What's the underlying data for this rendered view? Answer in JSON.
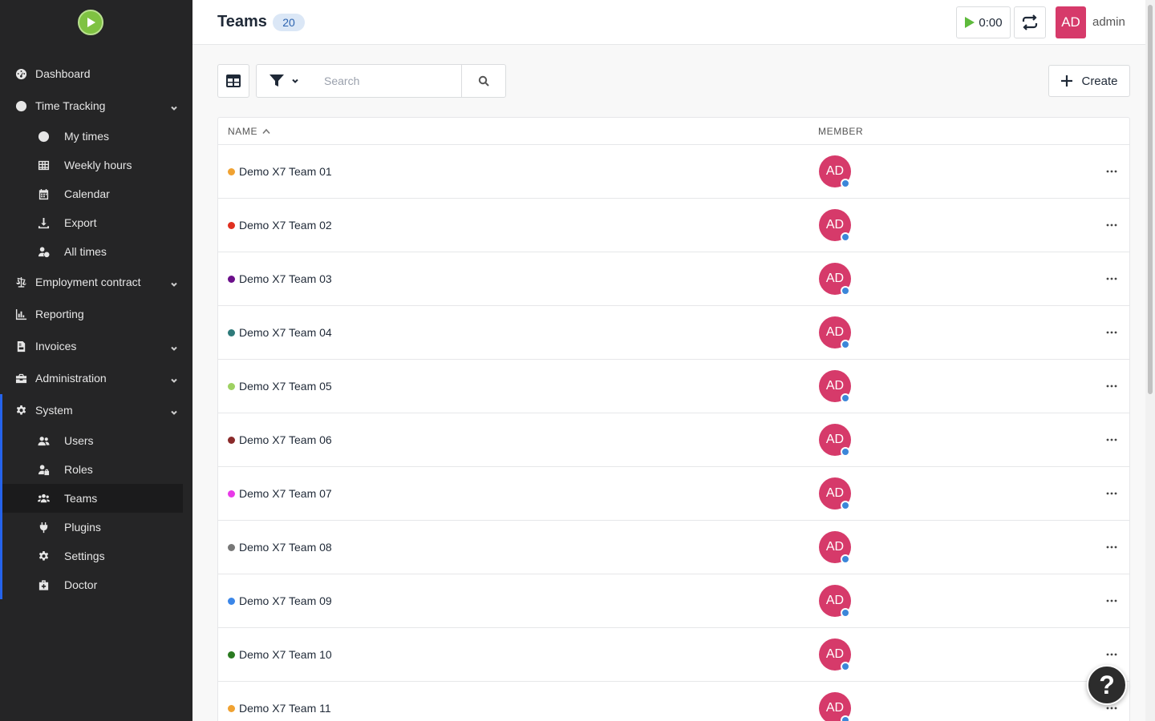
{
  "sidebar": {
    "logo_icon": "play-logo-icon",
    "items": [
      {
        "label": "Dashboard",
        "icon": "dashboard-icon"
      },
      {
        "label": "Time Tracking",
        "icon": "clock-icon"
      },
      {
        "label": "My times",
        "icon": "clock-icon"
      },
      {
        "label": "Weekly hours",
        "icon": "table-icon"
      },
      {
        "label": "Calendar",
        "icon": "calendar-icon"
      },
      {
        "label": "Export",
        "icon": "download-icon"
      },
      {
        "label": "All times",
        "icon": "user-clock-icon"
      },
      {
        "label": "Employment contract",
        "icon": "balance-scale-icon"
      },
      {
        "label": "Reporting",
        "icon": "chart-icon"
      },
      {
        "label": "Invoices",
        "icon": "invoice-icon"
      },
      {
        "label": "Administration",
        "icon": "toolbox-icon"
      },
      {
        "label": "System",
        "icon": "gear-icon"
      },
      {
        "label": "Users",
        "icon": "users-icon"
      },
      {
        "label": "Roles",
        "icon": "user-lock-icon"
      },
      {
        "label": "Teams",
        "icon": "team-icon"
      },
      {
        "label": "Plugins",
        "icon": "plug-icon"
      },
      {
        "label": "Settings",
        "icon": "gear-icon"
      },
      {
        "label": "Doctor",
        "icon": "medkit-icon"
      }
    ],
    "active_item": "Teams",
    "accent_color": "#2563eb"
  },
  "header": {
    "title": "Teams",
    "count": "20",
    "timer": "0:00",
    "user_initials": "AD",
    "user_name": "admin",
    "user_color": "#d63a6a"
  },
  "toolbar": {
    "search_placeholder": "Search",
    "create_label": "Create"
  },
  "table": {
    "columns": {
      "name": "Name",
      "member": "Member"
    },
    "sort_column": "name",
    "sort_direction": "asc",
    "rows": [
      {
        "name": "Demo X7 Team 01",
        "color": "#f0a232",
        "member": "AD"
      },
      {
        "name": "Demo X7 Team 02",
        "color": "#e03020",
        "member": "AD"
      },
      {
        "name": "Demo X7 Team 03",
        "color": "#6b0f8a",
        "member": "AD"
      },
      {
        "name": "Demo X7 Team 04",
        "color": "#2e7a7a",
        "member": "AD"
      },
      {
        "name": "Demo X7 Team 05",
        "color": "#9ed162",
        "member": "AD"
      },
      {
        "name": "Demo X7 Team 06",
        "color": "#8a2a2a",
        "member": "AD"
      },
      {
        "name": "Demo X7 Team 07",
        "color": "#e83ae8",
        "member": "AD"
      },
      {
        "name": "Demo X7 Team 08",
        "color": "#777777",
        "member": "AD"
      },
      {
        "name": "Demo X7 Team 09",
        "color": "#3b86e8",
        "member": "AD"
      },
      {
        "name": "Demo X7 Team 10",
        "color": "#2a7a20",
        "member": "AD"
      },
      {
        "name": "Demo X7 Team 11",
        "color": "#f0a232",
        "member": "AD"
      }
    ]
  },
  "help": {
    "label": "?"
  }
}
